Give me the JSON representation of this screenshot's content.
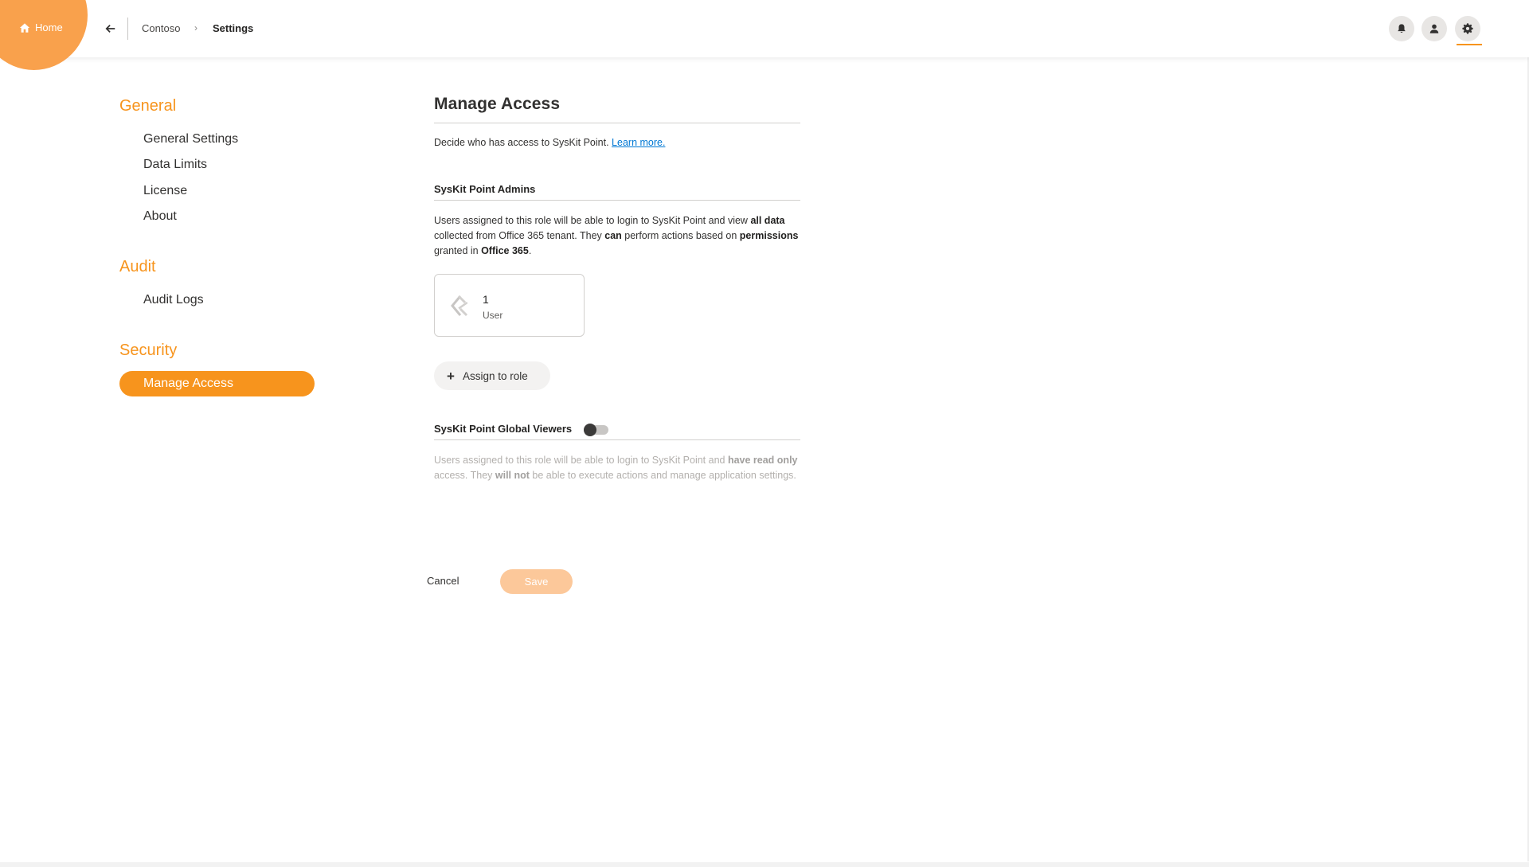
{
  "header": {
    "home_label": "Home",
    "breadcrumb": [
      "Contoso",
      "Settings"
    ],
    "breadcrumb_separator": "›",
    "icons": [
      "home-icon",
      "back-arrow-icon",
      "bell-icon",
      "user-icon",
      "gear-icon"
    ]
  },
  "sidebar": {
    "sections": [
      {
        "title": "General",
        "items": [
          "General Settings",
          "Data Limits",
          "License",
          "About"
        ]
      },
      {
        "title": "Audit",
        "items": [
          "Audit Logs"
        ]
      },
      {
        "title": "Security",
        "items": [
          "Manage Access"
        ]
      }
    ],
    "active_item": "Manage Access"
  },
  "main": {
    "title": "Manage Access",
    "description": "Decide who has access to SysKit Point.",
    "learn_more": "Learn more.",
    "admins": {
      "title": "SysKit Point Admins",
      "text_1": "Users assigned to this role will be able to login to SysKit Point and view ",
      "bold_1": "all data",
      "text_2": " collected from Office 365 tenant. They ",
      "bold_2": "can",
      "text_3": " perform actions based on ",
      "bold_3": "permissions",
      "text_4": " granted in ",
      "bold_4": "Office 365",
      "text_5": ".",
      "card_count": "1",
      "card_label": "User",
      "assign_label": "Assign to role"
    },
    "viewers": {
      "title": "SysKit Point Global Viewers",
      "toggle_on": false,
      "text_1": "Users assigned to this role will be able to login to SysKit Point and ",
      "bold_1": "have read only",
      "text_2": " access. They ",
      "bold_2": "will not",
      "text_3": " be able to execute actions and manage application settings."
    },
    "cancel_label": "Cancel",
    "save_label": "Save"
  },
  "colors": {
    "accent": "#f7941d",
    "home_blob": "#f9a14c",
    "save_disabled": "#fcc89a",
    "link": "#0078d4"
  }
}
